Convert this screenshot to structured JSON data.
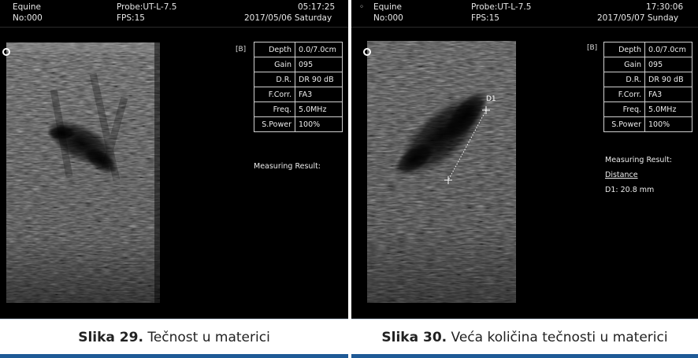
{
  "left": {
    "header": {
      "app": "Equine",
      "probe": "Probe:UT-L-7.5",
      "time": "05:17:25",
      "number": "No:000",
      "fps": "FPS:15",
      "date": "2017/05/06 Saturday"
    },
    "mode_tag": "[B]",
    "params": [
      {
        "key": "Depth",
        "value": "0.0/7.0cm"
      },
      {
        "key": "Gain",
        "value": "095"
      },
      {
        "key": "D.R.",
        "value": "DR 90 dB"
      },
      {
        "key": "F.Corr.",
        "value": "FA3"
      },
      {
        "key": "Freq.",
        "value": "5.0MHz"
      },
      {
        "key": "S.Power",
        "value": "100%"
      }
    ],
    "measuring_title": "Measuring Result:",
    "caption": {
      "label": "Slika 29.",
      "text": " Tečnost u materici"
    }
  },
  "right": {
    "header": {
      "app": "Equine",
      "probe": "Probe:UT-L-7.5",
      "time": "17:30:06",
      "number": "No:000",
      "fps": "FPS:15",
      "date": "2017/05/07 Sunday"
    },
    "mode_tag": "[B]",
    "params": [
      {
        "key": "Depth",
        "value": "0.0/7.0cm"
      },
      {
        "key": "Gain",
        "value": "095"
      },
      {
        "key": "D.R.",
        "value": "DR 90 dB"
      },
      {
        "key": "F.Corr.",
        "value": "FA3"
      },
      {
        "key": "Freq.",
        "value": "5.0MHz"
      },
      {
        "key": "S.Power",
        "value": "100%"
      }
    ],
    "measuring_title": "Measuring Result:",
    "measure_type": "Distance",
    "measure_value": "D1: 20.8 mm",
    "marker": "D1",
    "caption": {
      "label": "Slika 30.",
      "text": " Veća količina tečnosti u materici"
    }
  },
  "colors": {
    "caption_bar": "#1f5a96",
    "screen_bg": "#000000",
    "text": "#e8e8e8"
  }
}
